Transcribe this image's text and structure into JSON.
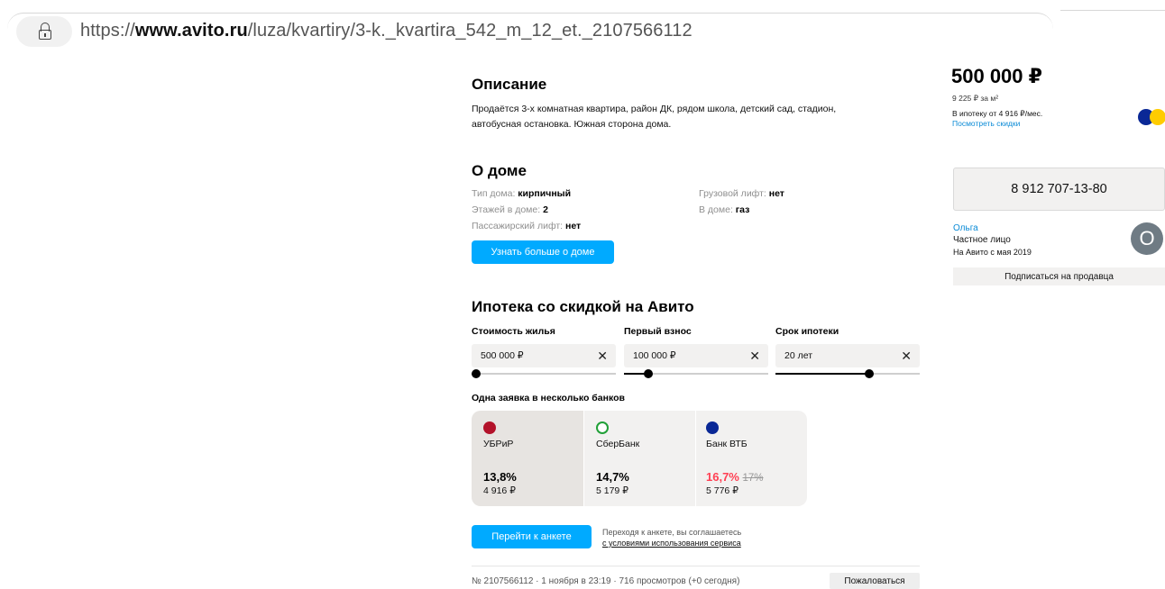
{
  "browser": {
    "url_scheme": "https://",
    "url_domain": "www.avito.ru",
    "url_path": "/luza/kvartiry/3-k._kvartira_542_m_12_et._2107566112"
  },
  "description": {
    "title": "Описание",
    "text": "Продаётся 3-х комнатная квартира, район ДК, рядом школа, детский сад, стадион, автобусная остановка. Южная сторона дома."
  },
  "house": {
    "title": "О доме",
    "props": [
      {
        "label": "Тип дома:",
        "value": "кирпичный"
      },
      {
        "label": "Этажей в доме:",
        "value": "2"
      },
      {
        "label": "Пассажирский лифт:",
        "value": "нет"
      },
      {
        "label": "Грузовой лифт:",
        "value": "нет"
      },
      {
        "label": "В доме:",
        "value": "газ"
      }
    ],
    "more_button": "Узнать больше о доме"
  },
  "mortgage": {
    "title": "Ипотека со скидкой на Авито",
    "fields": [
      {
        "label": "Стоимость жилья",
        "value": "500 000 ₽",
        "clear": "✕",
        "level": 0.03
      },
      {
        "label": "Первый взнос",
        "value": "100 000 ₽",
        "clear": "✕",
        "level": 0.17
      },
      {
        "label": "Срок ипотеки",
        "value": "20 лет",
        "clear": "✕",
        "level": 0.65
      }
    ],
    "banks_title": "Одна заявка в несколько банков",
    "banks": [
      {
        "name": "УБРиР",
        "rate": "13,8%",
        "old_rate": "",
        "payment": "4 916 ₽",
        "icon": "ubrir-logo-icon",
        "color": "#b3122a"
      },
      {
        "name": "СберБанк",
        "rate": "14,7%",
        "old_rate": "",
        "payment": "5 179 ₽",
        "icon": "sberbank-logo-icon",
        "color": "#21a038"
      },
      {
        "name": "Банк ВТБ",
        "rate": "16,7%",
        "old_rate": "17%",
        "payment": "5 776 ₽",
        "icon": "vtb-logo-icon",
        "color": "#0a2896"
      }
    ],
    "apply_button": "Перейти к анкете",
    "consent_text": "Переходя к анкете, вы соглашаетесь",
    "consent_link": "с условиями использования сервиса"
  },
  "footer": {
    "meta": "№ 2107566112 · 1 ноября в 23:19 · 716 просмотров (+0 сегодня)",
    "complain_button": "Пожаловаться"
  },
  "sidebar": {
    "price": "500 000 ₽",
    "price_per_m2": "9 225 ₽ за м²",
    "mortgage_from": "В ипотеку от 4 916 ₽/мес.",
    "discounts_link": "Посмотреть скидки",
    "phone": "8 912 707-13-80",
    "seller_name": "Ольга",
    "seller_type": "Частное лицо",
    "seller_since": "На Авито с мая 2019",
    "avatar_letter": "О",
    "subscribe_button": "Подписаться на продавца"
  },
  "colors": {
    "accent_blue": "#00aaff",
    "link_blue": "#0a8ad6",
    "discount_red": "#ff4053"
  }
}
